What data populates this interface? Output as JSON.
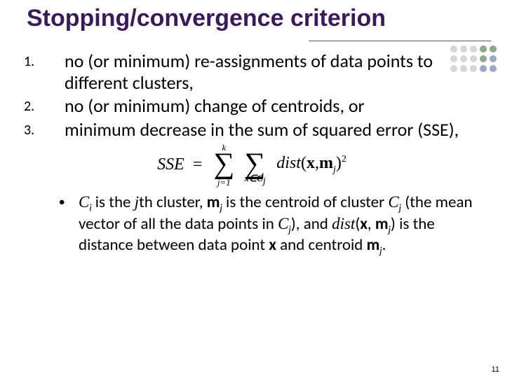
{
  "title": "Stopping/convergence criterion",
  "items": [
    {
      "num": "1.",
      "text": "no (or minimum) re-assignments of data points to different clusters,"
    },
    {
      "num": "2.",
      "text": "no (or minimum) change of centroids, or"
    },
    {
      "num": "3.",
      "text": "minimum decrease in the sum of squared error (SSE),"
    }
  ],
  "equation": {
    "lhs": "SSE",
    "eq": "=",
    "sum1_top": "k",
    "sum1_bottom": "j=1",
    "sum2_bottom_prefix": "x∈C",
    "sum2_bottom_sub": "j",
    "dist": "dist",
    "open": "(",
    "arg1": "x",
    "comma": ",",
    "arg2": "m",
    "arg2_sub": "j",
    "close": ")",
    "power": "2"
  },
  "bullet": {
    "pieces": {
      "a": "C",
      "a_sub": "i",
      "b": " is the ",
      "c": "j",
      "d": "th cluster, ",
      "e": "m",
      "e_sub": "j",
      "f": " is the centroid of cluster ",
      "g": "C",
      "g_sub": "j",
      "h": " (the mean vector of all the data points in ",
      "i": "C",
      "i_sub": "j",
      "j": "), and ",
      "k": "dist",
      "l": "(",
      "m": "x",
      "n": ", ",
      "o": "m",
      "o_sub": "j",
      "p": ") is the distance between data point ",
      "q": "x",
      "r": " and centroid ",
      "s": "m",
      "s_sub": "j",
      "t": "."
    }
  },
  "page_number": "11"
}
